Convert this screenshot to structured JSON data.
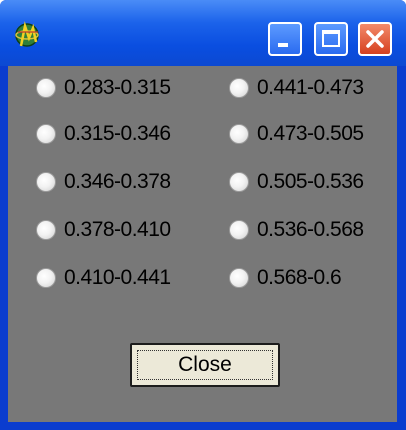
{
  "window": {
    "title": "",
    "titlebar_buttons": {
      "minimize_icon": "minimize-icon",
      "maximize_icon": "maximize-icon",
      "close_icon": "close-icon"
    },
    "colors": {
      "frame": "#0a3ccf",
      "client_bg": "#787878",
      "button_face": "#ece9d8",
      "close_red": "#d6401f"
    }
  },
  "radio_options": {
    "left": [
      "0.283-0.315",
      "0.315-0.346",
      "0.346-0.378",
      "0.378-0.410",
      "0.410-0.441"
    ],
    "right": [
      "0.441-0.473",
      "0.473-0.505",
      "0.505-0.536",
      "0.536-0.568",
      "0.568-0.6"
    ]
  },
  "actions": {
    "close_label": "Close"
  }
}
